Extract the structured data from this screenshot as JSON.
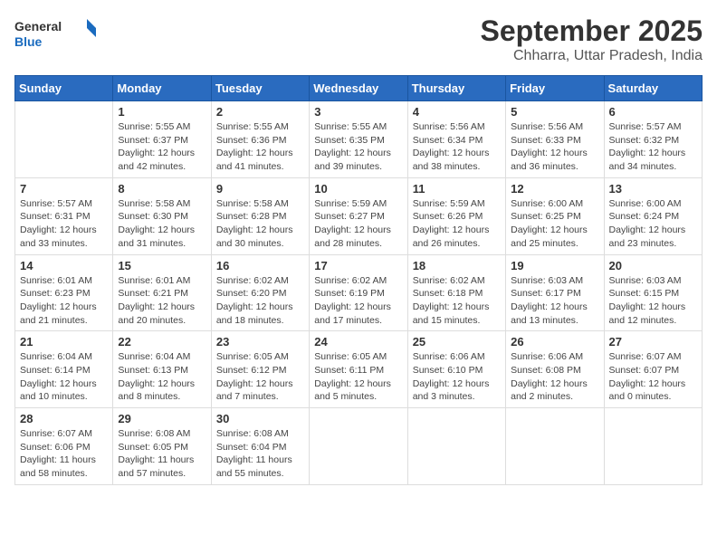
{
  "logo": {
    "line1": "General",
    "line2": "Blue"
  },
  "title": "September 2025",
  "subtitle": "Chharra, Uttar Pradesh, India",
  "days_of_week": [
    "Sunday",
    "Monday",
    "Tuesday",
    "Wednesday",
    "Thursday",
    "Friday",
    "Saturday"
  ],
  "weeks": [
    [
      null,
      {
        "day": "1",
        "sunrise": "5:55 AM",
        "sunset": "6:37 PM",
        "daylight": "12 hours and 42 minutes."
      },
      {
        "day": "2",
        "sunrise": "5:55 AM",
        "sunset": "6:36 PM",
        "daylight": "12 hours and 41 minutes."
      },
      {
        "day": "3",
        "sunrise": "5:55 AM",
        "sunset": "6:35 PM",
        "daylight": "12 hours and 39 minutes."
      },
      {
        "day": "4",
        "sunrise": "5:56 AM",
        "sunset": "6:34 PM",
        "daylight": "12 hours and 38 minutes."
      },
      {
        "day": "5",
        "sunrise": "5:56 AM",
        "sunset": "6:33 PM",
        "daylight": "12 hours and 36 minutes."
      },
      {
        "day": "6",
        "sunrise": "5:57 AM",
        "sunset": "6:32 PM",
        "daylight": "12 hours and 34 minutes."
      }
    ],
    [
      {
        "day": "7",
        "sunrise": "5:57 AM",
        "sunset": "6:31 PM",
        "daylight": "12 hours and 33 minutes."
      },
      {
        "day": "8",
        "sunrise": "5:58 AM",
        "sunset": "6:30 PM",
        "daylight": "12 hours and 31 minutes."
      },
      {
        "day": "9",
        "sunrise": "5:58 AM",
        "sunset": "6:28 PM",
        "daylight": "12 hours and 30 minutes."
      },
      {
        "day": "10",
        "sunrise": "5:59 AM",
        "sunset": "6:27 PM",
        "daylight": "12 hours and 28 minutes."
      },
      {
        "day": "11",
        "sunrise": "5:59 AM",
        "sunset": "6:26 PM",
        "daylight": "12 hours and 26 minutes."
      },
      {
        "day": "12",
        "sunrise": "6:00 AM",
        "sunset": "6:25 PM",
        "daylight": "12 hours and 25 minutes."
      },
      {
        "day": "13",
        "sunrise": "6:00 AM",
        "sunset": "6:24 PM",
        "daylight": "12 hours and 23 minutes."
      }
    ],
    [
      {
        "day": "14",
        "sunrise": "6:01 AM",
        "sunset": "6:23 PM",
        "daylight": "12 hours and 21 minutes."
      },
      {
        "day": "15",
        "sunrise": "6:01 AM",
        "sunset": "6:21 PM",
        "daylight": "12 hours and 20 minutes."
      },
      {
        "day": "16",
        "sunrise": "6:02 AM",
        "sunset": "6:20 PM",
        "daylight": "12 hours and 18 minutes."
      },
      {
        "day": "17",
        "sunrise": "6:02 AM",
        "sunset": "6:19 PM",
        "daylight": "12 hours and 17 minutes."
      },
      {
        "day": "18",
        "sunrise": "6:02 AM",
        "sunset": "6:18 PM",
        "daylight": "12 hours and 15 minutes."
      },
      {
        "day": "19",
        "sunrise": "6:03 AM",
        "sunset": "6:17 PM",
        "daylight": "12 hours and 13 minutes."
      },
      {
        "day": "20",
        "sunrise": "6:03 AM",
        "sunset": "6:15 PM",
        "daylight": "12 hours and 12 minutes."
      }
    ],
    [
      {
        "day": "21",
        "sunrise": "6:04 AM",
        "sunset": "6:14 PM",
        "daylight": "12 hours and 10 minutes."
      },
      {
        "day": "22",
        "sunrise": "6:04 AM",
        "sunset": "6:13 PM",
        "daylight": "12 hours and 8 minutes."
      },
      {
        "day": "23",
        "sunrise": "6:05 AM",
        "sunset": "6:12 PM",
        "daylight": "12 hours and 7 minutes."
      },
      {
        "day": "24",
        "sunrise": "6:05 AM",
        "sunset": "6:11 PM",
        "daylight": "12 hours and 5 minutes."
      },
      {
        "day": "25",
        "sunrise": "6:06 AM",
        "sunset": "6:10 PM",
        "daylight": "12 hours and 3 minutes."
      },
      {
        "day": "26",
        "sunrise": "6:06 AM",
        "sunset": "6:08 PM",
        "daylight": "12 hours and 2 minutes."
      },
      {
        "day": "27",
        "sunrise": "6:07 AM",
        "sunset": "6:07 PM",
        "daylight": "12 hours and 0 minutes."
      }
    ],
    [
      {
        "day": "28",
        "sunrise": "6:07 AM",
        "sunset": "6:06 PM",
        "daylight": "11 hours and 58 minutes."
      },
      {
        "day": "29",
        "sunrise": "6:08 AM",
        "sunset": "6:05 PM",
        "daylight": "11 hours and 57 minutes."
      },
      {
        "day": "30",
        "sunrise": "6:08 AM",
        "sunset": "6:04 PM",
        "daylight": "11 hours and 55 minutes."
      },
      null,
      null,
      null,
      null
    ]
  ],
  "labels": {
    "sunrise": "Sunrise:",
    "sunset": "Sunset:",
    "daylight": "Daylight:"
  }
}
